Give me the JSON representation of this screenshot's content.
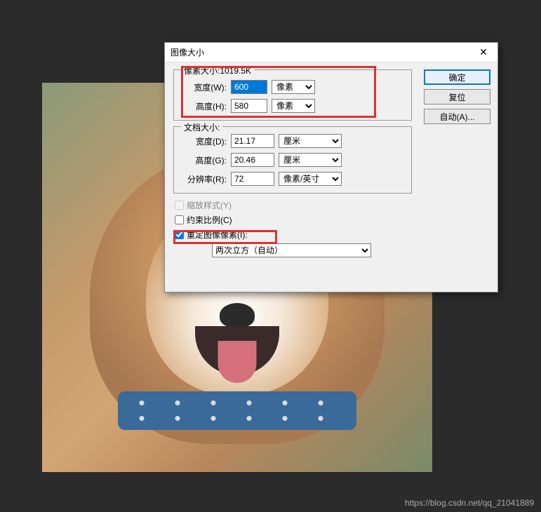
{
  "dialog": {
    "title": "图像大小",
    "pixel_dims_legend": "像素大小:1019.5K",
    "width_label": "宽度(W):",
    "width_value": "600",
    "width_unit": "像素",
    "height_label": "高度(H):",
    "height_value": "580",
    "height_unit": "像素",
    "doc_size_legend": "文档大小:",
    "doc_width_label": "宽度(D):",
    "doc_width_value": "21.17",
    "doc_width_unit": "厘米",
    "doc_height_label": "高度(G):",
    "doc_height_value": "20.46",
    "doc_height_unit": "厘米",
    "resolution_label": "分辨率(R):",
    "resolution_value": "72",
    "resolution_unit": "像素/英寸",
    "scale_styles": "缩放样式(Y)",
    "constrain": "约束比例(C)",
    "resample": "重定图像像素(I):",
    "resample_method": "两次立方（自动）",
    "ok": "确定",
    "reset": "复位",
    "auto": "自动(A)..."
  },
  "watermark": "https://blog.csdn.net/qq_21041889"
}
